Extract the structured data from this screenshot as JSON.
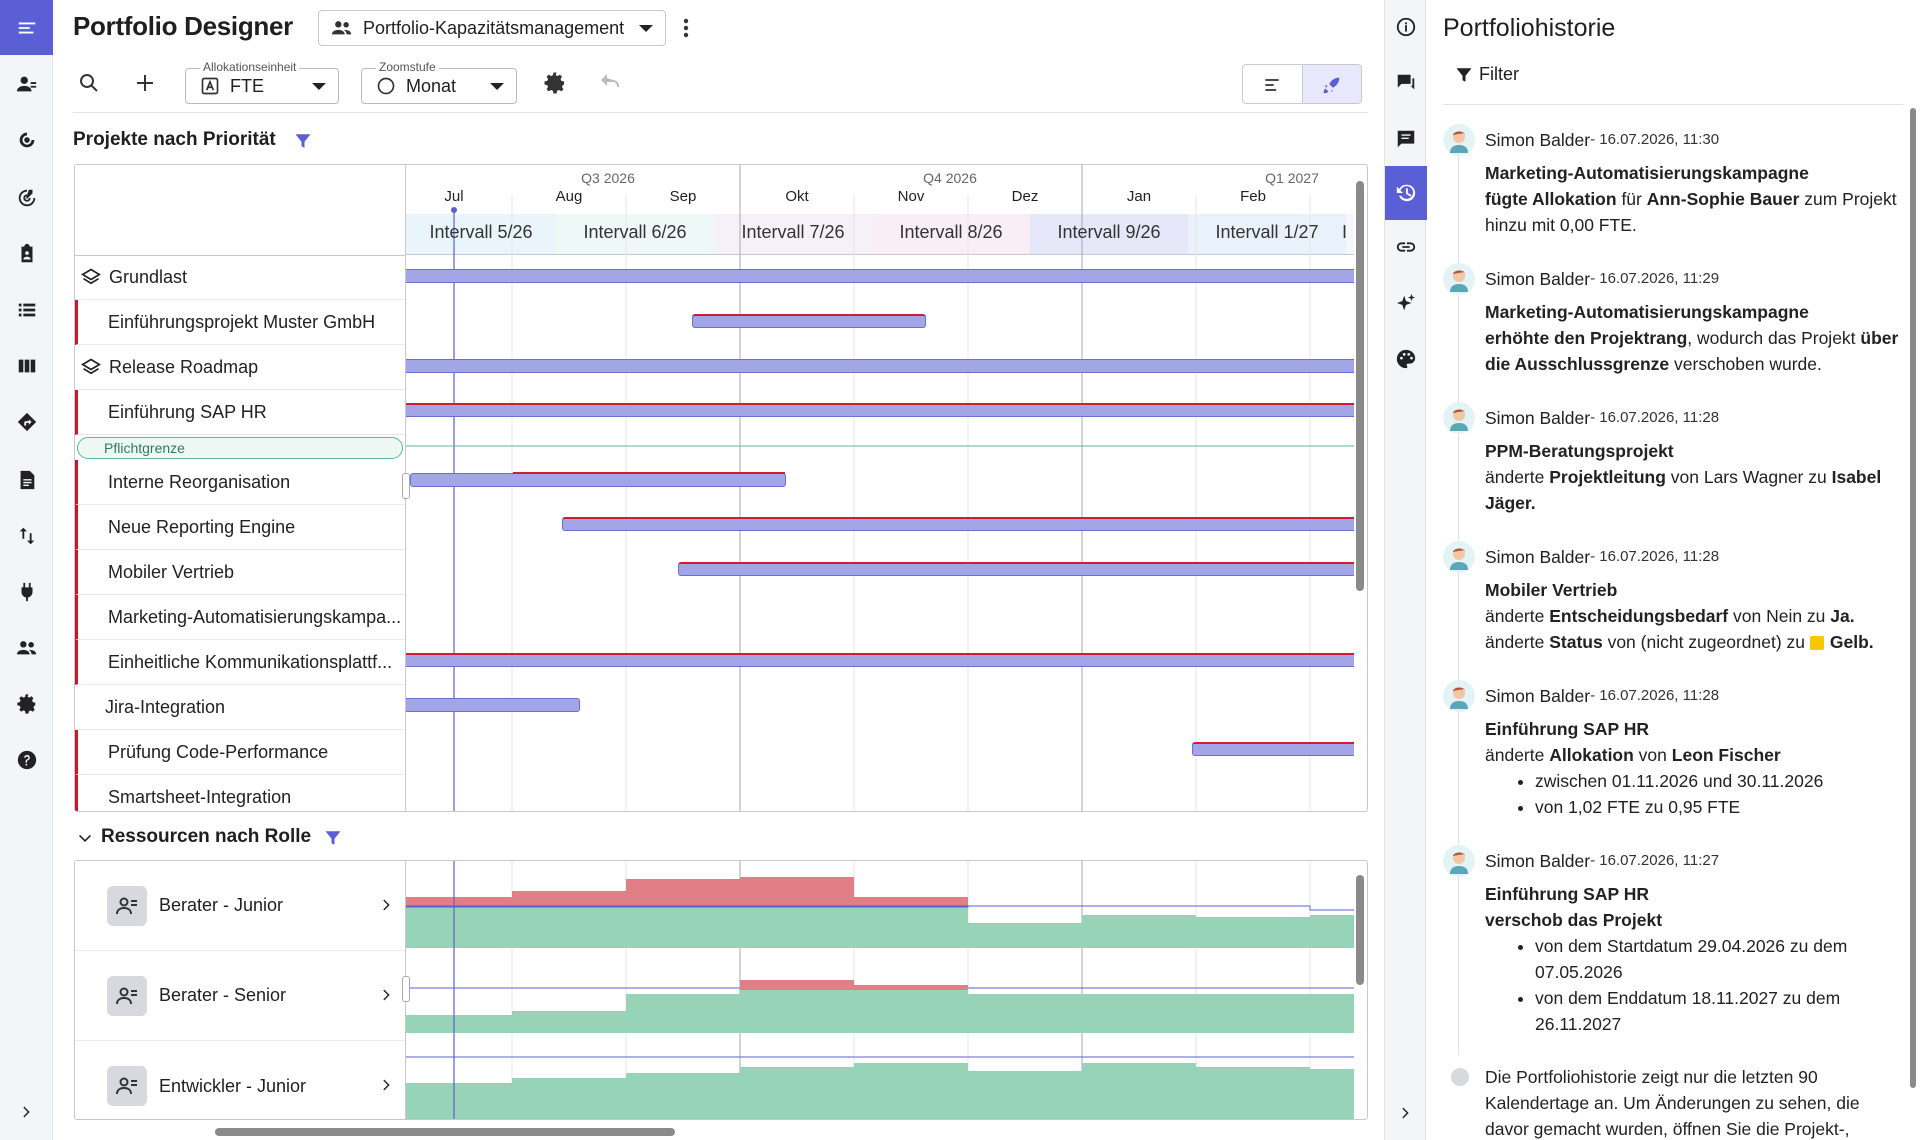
{
  "app": {
    "title": "Portfolio Designer"
  },
  "portfolio_select": {
    "value": "Portfolio-Kapazitätsmanagement"
  },
  "toolbar": {
    "allocation": {
      "label": "Allokationseinheit",
      "value": "FTE"
    },
    "zoom": {
      "label": "Zoomstufe",
      "value": "Monat"
    }
  },
  "projects_section": {
    "title": "Projekte nach Priorität"
  },
  "timeline": {
    "quarters": [
      "Q3 2026",
      "Q4 2026",
      "Q1 2027"
    ],
    "months": [
      "Jul",
      "Aug",
      "Sep",
      "Okt",
      "Nov",
      "Dez",
      "Jan",
      "Feb"
    ],
    "intervals": [
      "Intervall 5/26",
      "Intervall 6/26",
      "Intervall 7/26",
      "Intervall 8/26",
      "Intervall 9/26",
      "Intervall 1/27",
      "I"
    ]
  },
  "projects": [
    {
      "name": "Grundlast",
      "group": true
    },
    {
      "name": "Einführungsprojekt Muster GmbH"
    },
    {
      "name": "Release Roadmap",
      "group": true
    },
    {
      "name": "Einführung SAP HR"
    },
    {
      "name": "Interne Reorganisation"
    },
    {
      "name": "Neue Reporting Engine"
    },
    {
      "name": "Mobiler Vertrieb"
    },
    {
      "name": "Marketing-Automatisierungskampa..."
    },
    {
      "name": "Einheitliche Kommunikationsplattf..."
    },
    {
      "name": "Jira-Integration"
    },
    {
      "name": "Prüfung Code-Performance"
    },
    {
      "name": "Smartsheet-Integration"
    }
  ],
  "threshold": {
    "label": "Pflichtgrenze"
  },
  "resources_section": {
    "title": "Ressourcen nach Rolle"
  },
  "resources": [
    {
      "name": "Berater - Junior"
    },
    {
      "name": "Berater - Senior"
    },
    {
      "name": "Entwickler - Junior"
    }
  ],
  "history": {
    "title": "Portfoliohistorie",
    "filter_label": "Filter",
    "user": "Simon Balder",
    "entries": [
      {
        "ts": " - 16.07.2026, 11:30"
      },
      {
        "ts": " - 16.07.2026, 11:29"
      },
      {
        "ts": " - 16.07.2026, 11:28"
      },
      {
        "ts": " - 16.07.2026, 11:28"
      },
      {
        "ts": " - 16.07.2026, 11:28"
      },
      {
        "ts": " - 16.07.2026, 11:27"
      }
    ],
    "texts": {
      "e0_p": "Marketing-Automatisierungskampagne",
      "e0_a": "fügte Allokation",
      "e0_b": " für ",
      "e0_c": "Ann-Sophie Bauer",
      "e0_d": " zum Projekt hinzu mit 0,00 FTE.",
      "e1_p": "Marketing-Automatisierungskampagne",
      "e1_a": "erhöhte den Projektrang",
      "e1_b": ", wodurch das Projekt ",
      "e1_c": "über die Ausschlussgrenze",
      "e1_d": " verschoben wurde.",
      "e2_p": "PPM-Beratungsprojekt",
      "e2_a": "änderte ",
      "e2_b": "Projektleitung",
      "e2_c": " von Lars Wagner zu ",
      "e2_d": "Isabel Jäger.",
      "e3_p": "Mobiler Vertrieb",
      "e3_a": "änderte ",
      "e3_b": "Entscheidungsbedarf",
      "e3_c": " von Nein zu ",
      "e3_d": "Ja.",
      "e3_e": "änderte ",
      "e3_f": "Status",
      "e3_g": " von (nicht zugeordnet) zu ",
      "e3_h": "Gelb.",
      "e4_p": "Einführung SAP HR",
      "e4_a": "änderte ",
      "e4_b": "Allokation",
      "e4_c": " von ",
      "e4_d": "Leon Fischer",
      "e4_l1": "zwischen 01.11.2026 und 30.11.2026",
      "e4_l2": "von 1,02 FTE zu 0,95 FTE",
      "e5_p": "Einführung SAP HR",
      "e5_a": "verschob das Projekt",
      "e5_l1": "von dem Startdatum 29.04.2026 zu dem 07.05.2026",
      "e5_l2": "von dem Enddatum 18.11.2027 zu dem 26.11.2027",
      "note": "Die Portfoliohistorie zeigt nur die letzten 90 Kalendertage an. Um Änderungen zu sehen, die davor gemacht wurden, öffnen Sie die Projekt-,"
    }
  },
  "colors": {
    "accent": "#5b5fd6",
    "bar": "#a3a6e6",
    "over": "#e07f85",
    "ok": "#97d3b7",
    "critical": "#d11e2f"
  }
}
